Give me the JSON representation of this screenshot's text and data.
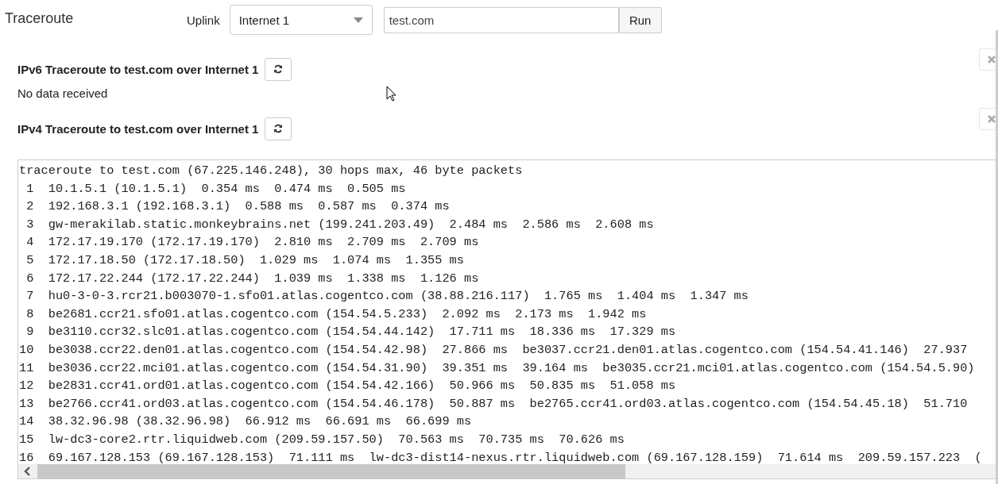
{
  "title": "Traceroute",
  "uplink": {
    "label": "Uplink",
    "value": "Internet 1"
  },
  "target": {
    "value": "test.com"
  },
  "run_button": "Run",
  "sections": [
    {
      "heading": "IPv6 Traceroute to test.com over Internet 1",
      "message": "No data received"
    },
    {
      "heading": "IPv4 Traceroute to test.com over Internet 1",
      "output": [
        "traceroute to test.com (67.225.146.248), 30 hops max, 46 byte packets",
        " 1  10.1.5.1 (10.1.5.1)  0.354 ms  0.474 ms  0.505 ms",
        " 2  192.168.3.1 (192.168.3.1)  0.588 ms  0.587 ms  0.374 ms",
        " 3  gw-merakilab.static.monkeybrains.net (199.241.203.49)  2.484 ms  2.586 ms  2.608 ms",
        " 4  172.17.19.170 (172.17.19.170)  2.810 ms  2.709 ms  2.709 ms",
        " 5  172.17.18.50 (172.17.18.50)  1.029 ms  1.074 ms  1.355 ms",
        " 6  172.17.22.244 (172.17.22.244)  1.039 ms  1.338 ms  1.126 ms",
        " 7  hu0-3-0-3.rcr21.b003070-1.sfo01.atlas.cogentco.com (38.88.216.117)  1.765 ms  1.404 ms  1.347 ms",
        " 8  be2681.ccr21.sfo01.atlas.cogentco.com (154.54.5.233)  2.092 ms  2.173 ms  1.942 ms",
        " 9  be3110.ccr32.slc01.atlas.cogentco.com (154.54.44.142)  17.711 ms  18.336 ms  17.329 ms",
        "10  be3038.ccr22.den01.atlas.cogentco.com (154.54.42.98)  27.866 ms  be3037.ccr21.den01.atlas.cogentco.com (154.54.41.146)  27.937",
        "11  be3036.ccr22.mci01.atlas.cogentco.com (154.54.31.90)  39.351 ms  39.164 ms  be3035.ccr21.mci01.atlas.cogentco.com (154.54.5.90)",
        "12  be2831.ccr41.ord01.atlas.cogentco.com (154.54.42.166)  50.966 ms  50.835 ms  51.058 ms",
        "13  be2766.ccr41.ord03.atlas.cogentco.com (154.54.46.178)  50.887 ms  be2765.ccr41.ord03.atlas.cogentco.com (154.54.45.18)  51.710",
        "14  38.32.96.98 (38.32.96.98)  66.912 ms  66.691 ms  66.699 ms",
        "15  lw-dc3-core2.rtr.liquidweb.com (209.59.157.50)  70.563 ms  70.735 ms  70.626 ms",
        "16  69.167.128.153 (69.167.128.153)  71.111 ms  lw-dc3-dist14-nexus.rtr.liquidweb.com (69.167.128.159)  71.614 ms  209.59.157.223  ("
      ]
    }
  ]
}
